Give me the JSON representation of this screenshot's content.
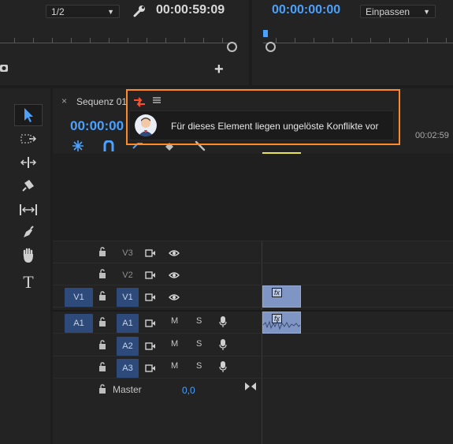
{
  "source_monitor": {
    "resolution": "1/2",
    "timecode": "00:00:59:09"
  },
  "program_monitor": {
    "timecode": "00:00:00:00",
    "fit": "Einpassen"
  },
  "timeline": {
    "tab_label": "Sequenz 01",
    "timecode": "00:00:00",
    "ruler_time": "00:02:59",
    "tooltip": "Für dieses Element liegen ungelöste Konflikte vor",
    "tracks": [
      {
        "label": "V3",
        "src": "",
        "kind": "video"
      },
      {
        "label": "V2",
        "src": "",
        "kind": "video"
      },
      {
        "label": "V1",
        "src": "V1",
        "kind": "video"
      },
      {
        "label": "A1",
        "src": "A1",
        "kind": "audio"
      },
      {
        "label": "A2",
        "src": "",
        "kind": "audio"
      },
      {
        "label": "A3",
        "src": "",
        "kind": "audio"
      }
    ],
    "mute": "M",
    "solo": "S",
    "master_label": "Master",
    "master_value": "0,0",
    "clip_badge": "fx"
  },
  "colors": {
    "accent_blue": "#4aa1ff",
    "track_blue": "#2e4a7a",
    "clip": "#7f95c4",
    "highlight_orange": "#ff8a2a"
  }
}
